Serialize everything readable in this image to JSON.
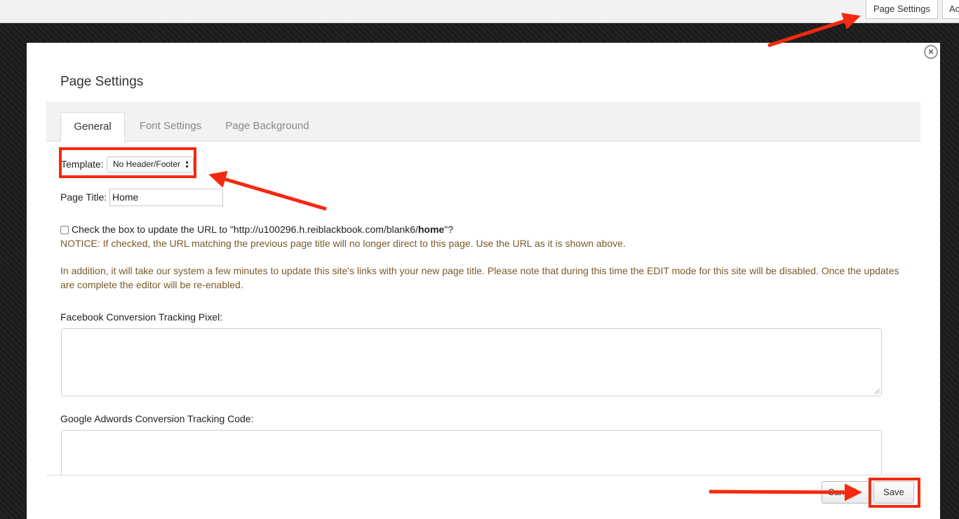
{
  "toolbar": {
    "page_settings_label": "Page Settings",
    "cut_button_label": "Ac"
  },
  "modal": {
    "title": "Page Settings",
    "close_glyph": "×",
    "tabs": [
      {
        "label": "General",
        "active": true
      },
      {
        "label": "Font Settings",
        "active": false
      },
      {
        "label": "Page Background",
        "active": false
      }
    ],
    "template": {
      "label": "Template:",
      "selected": "No Header/Footer",
      "arrows_glyph": "▲▼"
    },
    "page_title": {
      "label": "Page Title:",
      "value": "Home"
    },
    "update_url": {
      "text_before": "Check the box to update the URL to \"http://u100296.h.reiblackbook.com/blank6/",
      "text_bold": "home",
      "text_after": "\"?",
      "checked": false
    },
    "notice_1": "NOTICE: If checked, the URL matching the previous page title will no longer direct to this page. Use the URL as it is shown above.",
    "notice_2": "In addition, it will take our system a few minutes to update this site's links with your new page title. Please note that during this time the EDIT mode for this site will be disabled. Once the updates are complete the editor will be re-enabled.",
    "facebook_label": "Facebook Conversion Tracking Pixel:",
    "facebook_value": "",
    "google_label": "Google Adwords Conversion Tracking Code:",
    "google_value": "",
    "cancel_label": "Cancel",
    "save_label": "Save"
  },
  "colors": {
    "annotation": "#f4290f",
    "notice_text": "#7a5a28"
  }
}
